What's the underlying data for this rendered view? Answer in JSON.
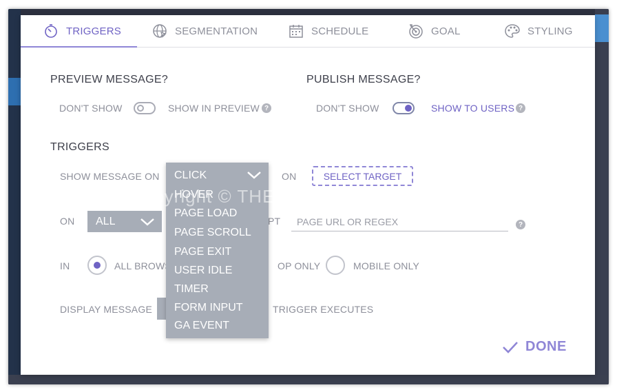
{
  "tabs": [
    {
      "label": "TRIGGERS",
      "icon": "stopwatch-icon",
      "active": true
    },
    {
      "label": "SEGMENTATION",
      "icon": "globe-icon",
      "active": false
    },
    {
      "label": "SCHEDULE",
      "icon": "calendar-icon",
      "active": false
    },
    {
      "label": "GOAL",
      "icon": "target-icon",
      "active": false
    },
    {
      "label": "STYLING",
      "icon": "palette-icon",
      "active": false
    }
  ],
  "preview": {
    "title": "PREVIEW MESSAGE?",
    "off_label": "DON'T SHOW",
    "on_label": "SHOW IN PREVIEW",
    "enabled": false
  },
  "publish": {
    "title": "PUBLISH MESSAGE?",
    "off_label": "DON'T SHOW",
    "on_label": "SHOW TO USERS",
    "enabled": true
  },
  "triggers": {
    "title": "TRIGGERS",
    "show_on_label": "SHOW MESSAGE ON",
    "event_selected": "CLICK",
    "on_label": "ON",
    "select_target": "SELECT TARGET",
    "event_options": [
      "HOVER",
      "PAGE LOAD",
      "PAGE SCROLL",
      "PAGE EXIT",
      "USER IDLE",
      "TIMER",
      "FORM INPUT",
      "GA EVENT"
    ]
  },
  "pages": {
    "on_label": "ON",
    "scope_selected": "ALL",
    "except_fragment": "PT",
    "url_placeholder": "PAGE URL OR REGEX"
  },
  "browsers": {
    "in_label": "IN",
    "all_fragment": "ALL BROWS",
    "desktop_fragment": "OP ONLY",
    "mobile_label": "MOBILE ONLY",
    "selected": "all"
  },
  "display": {
    "label": "DISPLAY MESSAGE",
    "suffix": "TRIGGER EXECUTES"
  },
  "done_label": "DONE",
  "watermark": "Copyright © THESOFTWARE.SHOP",
  "colors": {
    "accent": "#6f63c4",
    "dropdown_bg": "#a7adb7",
    "text_muted": "#8d8f9a"
  }
}
